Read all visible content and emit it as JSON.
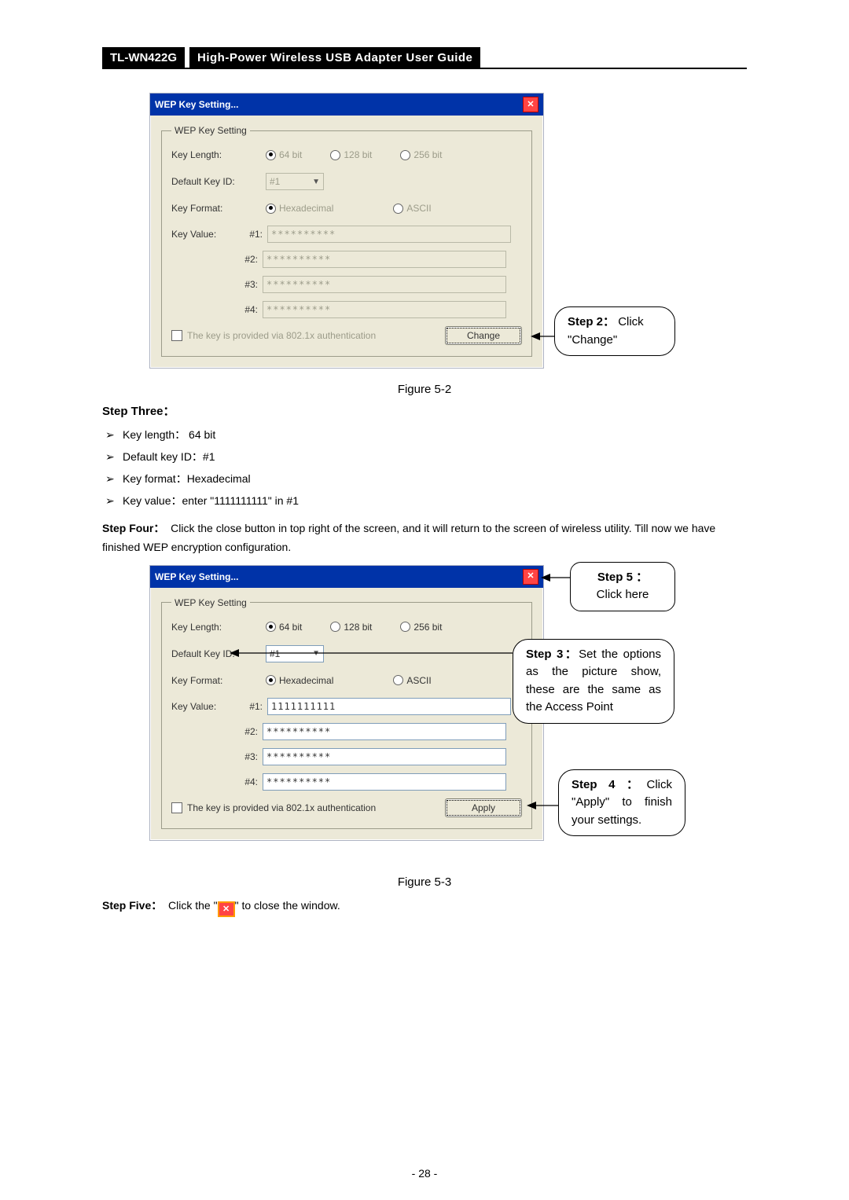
{
  "header": {
    "model": "TL-WN422G",
    "title": "High-Power Wireless USB Adapter User Guide"
  },
  "dlg_common": {
    "title": "WEP Key Setting...",
    "legend": "WEP Key Setting",
    "key_length_label": "Key Length:",
    "radio_64": "64 bit",
    "radio_128": "128 bit",
    "radio_256": "256 bit",
    "default_key_label": "Default Key ID:",
    "default_key_value": "#1",
    "key_format_label": "Key Format:",
    "radio_hex": "Hexadecimal",
    "radio_ascii": "ASCII",
    "key_value_label": "Key Value:",
    "kv1": "#1:",
    "kv2": "#2:",
    "kv3": "#3:",
    "kv4": "#4:",
    "auth_text": "The key is provided via 802.1x authentication",
    "close_glyph": "✕"
  },
  "dlg1": {
    "kv1_val": "**********",
    "kv2_val": "**********",
    "kv3_val": "**********",
    "kv4_val": "**********",
    "btn": "Change"
  },
  "dlg2": {
    "kv1_val": "1111111111",
    "kv2_val": "**********",
    "kv3_val": "**********",
    "kv4_val": "**********",
    "btn": "Apply"
  },
  "callouts": {
    "step2_a": "Step 2：",
    "step2_b": "Click",
    "step2_c": "\"Change\"",
    "step5_a": "Step 5 ：",
    "step5_b": "Click here",
    "step3_a": "Step 3：",
    "step3_b": "Set the options as the picture show, these are the same as the Access Point",
    "step4_a": "Step 4 ：",
    "step4_b": "Click \"Apply\" to finish your settings."
  },
  "text": {
    "fig1": "Figure 5-2",
    "step3_h": "Step Three：",
    "b1": "Key length： 64 bit",
    "b2": "Default key ID：#1",
    "b3": "Key format：Hexadecimal",
    "b4": "Key value：enter \"1111111111\" in #1",
    "step4_bold": "Step Four：",
    "step4_body": "Click the close button in top right of the screen, and it will return to the screen of wireless utility. Till now we have finished WEP encryption configuration.",
    "fig2": "Figure 5-3",
    "step5_bold": "Step Five：",
    "step5_a": "Click the \"",
    "step5_b": "\" to close the window.",
    "pageno": "- 28 -"
  }
}
